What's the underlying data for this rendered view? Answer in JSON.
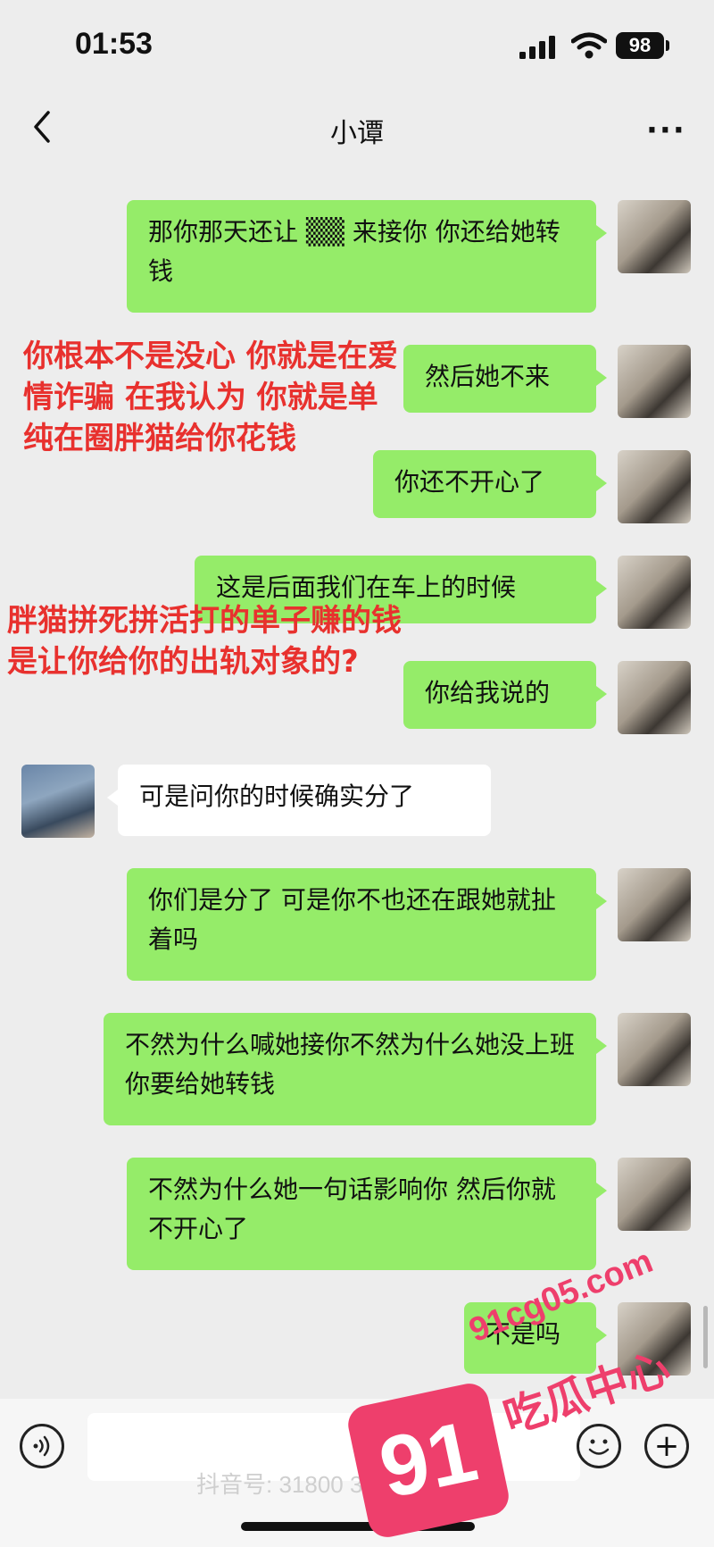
{
  "status": {
    "time": "01:53",
    "battery": "98"
  },
  "nav": {
    "title": "小谭",
    "more": "···"
  },
  "messages": [
    {
      "text": "那你那天还让 ▒▒ 来接你 你还给她转钱"
    },
    {
      "text": "然后她不来"
    },
    {
      "text": "你还不开心了"
    },
    {
      "text": "这是后面我们在车上的时候"
    },
    {
      "text": "你给我说的"
    },
    {
      "text": "可是问你的时候确实分了"
    },
    {
      "text": "你们是分了 可是你不也还在跟她就扯着吗"
    },
    {
      "text": "不然为什么喊她接你不然为什么她没上班你要给她转钱"
    },
    {
      "text": "不然为什么她一句话影响你 然后你就不开心了"
    },
    {
      "text": "不是吗"
    }
  ],
  "annotations": [
    {
      "text": "你根本不是没心 你就是在爱情诈骗 在我认为 你就是单纯在圈胖猫给你花钱"
    },
    {
      "text": "胖猫拼死拼活打的单子赚的钱 是让你给你的出轨对象的?"
    }
  ],
  "input_bar": {
    "plus": "+"
  },
  "footer": {
    "douyin": "抖音号: 31800 3B 3787"
  },
  "watermark": {
    "logo": "91",
    "text": "吃瓜中心",
    "url": "91cg05.com"
  },
  "colors": {
    "my_bubble": "#95ec69",
    "her_bubble": "#ffffff",
    "annotation": "#e8312e",
    "background": "#ededed"
  }
}
